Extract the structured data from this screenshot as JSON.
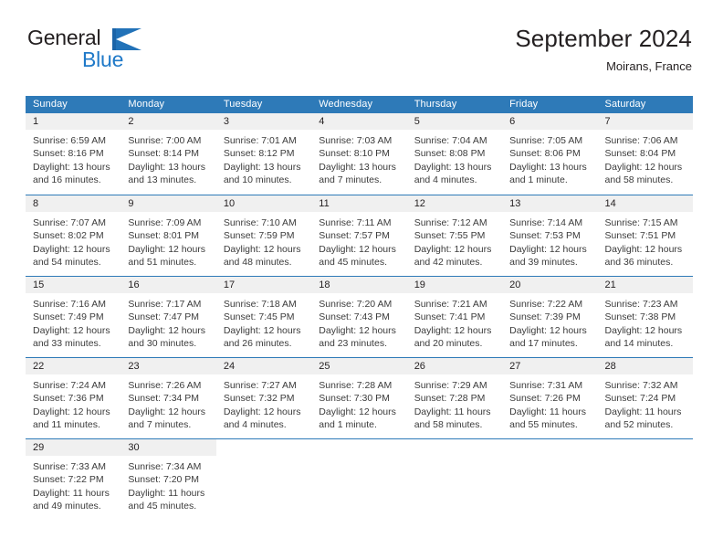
{
  "brand": {
    "name_top": "General",
    "name_bottom": "Blue",
    "mark": "flag-triangle-icon",
    "color_dark": "#231f20",
    "color_blue": "#1f79c8"
  },
  "header": {
    "title": "September 2024",
    "subtitle": "Moirans, France"
  },
  "theme": {
    "header_blue": "#2e7ab8",
    "day_number_band": "#f0f0f0",
    "text": "#231f20"
  },
  "weekdays": [
    "Sunday",
    "Monday",
    "Tuesday",
    "Wednesday",
    "Thursday",
    "Friday",
    "Saturday"
  ],
  "weeks": [
    [
      {
        "day": "1",
        "sunrise": "Sunrise: 6:59 AM",
        "sunset": "Sunset: 8:16 PM",
        "daylight": "Daylight: 13 hours and 16 minutes."
      },
      {
        "day": "2",
        "sunrise": "Sunrise: 7:00 AM",
        "sunset": "Sunset: 8:14 PM",
        "daylight": "Daylight: 13 hours and 13 minutes."
      },
      {
        "day": "3",
        "sunrise": "Sunrise: 7:01 AM",
        "sunset": "Sunset: 8:12 PM",
        "daylight": "Daylight: 13 hours and 10 minutes."
      },
      {
        "day": "4",
        "sunrise": "Sunrise: 7:03 AM",
        "sunset": "Sunset: 8:10 PM",
        "daylight": "Daylight: 13 hours and 7 minutes."
      },
      {
        "day": "5",
        "sunrise": "Sunrise: 7:04 AM",
        "sunset": "Sunset: 8:08 PM",
        "daylight": "Daylight: 13 hours and 4 minutes."
      },
      {
        "day": "6",
        "sunrise": "Sunrise: 7:05 AM",
        "sunset": "Sunset: 8:06 PM",
        "daylight": "Daylight: 13 hours and 1 minute."
      },
      {
        "day": "7",
        "sunrise": "Sunrise: 7:06 AM",
        "sunset": "Sunset: 8:04 PM",
        "daylight": "Daylight: 12 hours and 58 minutes."
      }
    ],
    [
      {
        "day": "8",
        "sunrise": "Sunrise: 7:07 AM",
        "sunset": "Sunset: 8:02 PM",
        "daylight": "Daylight: 12 hours and 54 minutes."
      },
      {
        "day": "9",
        "sunrise": "Sunrise: 7:09 AM",
        "sunset": "Sunset: 8:01 PM",
        "daylight": "Daylight: 12 hours and 51 minutes."
      },
      {
        "day": "10",
        "sunrise": "Sunrise: 7:10 AM",
        "sunset": "Sunset: 7:59 PM",
        "daylight": "Daylight: 12 hours and 48 minutes."
      },
      {
        "day": "11",
        "sunrise": "Sunrise: 7:11 AM",
        "sunset": "Sunset: 7:57 PM",
        "daylight": "Daylight: 12 hours and 45 minutes."
      },
      {
        "day": "12",
        "sunrise": "Sunrise: 7:12 AM",
        "sunset": "Sunset: 7:55 PM",
        "daylight": "Daylight: 12 hours and 42 minutes."
      },
      {
        "day": "13",
        "sunrise": "Sunrise: 7:14 AM",
        "sunset": "Sunset: 7:53 PM",
        "daylight": "Daylight: 12 hours and 39 minutes."
      },
      {
        "day": "14",
        "sunrise": "Sunrise: 7:15 AM",
        "sunset": "Sunset: 7:51 PM",
        "daylight": "Daylight: 12 hours and 36 minutes."
      }
    ],
    [
      {
        "day": "15",
        "sunrise": "Sunrise: 7:16 AM",
        "sunset": "Sunset: 7:49 PM",
        "daylight": "Daylight: 12 hours and 33 minutes."
      },
      {
        "day": "16",
        "sunrise": "Sunrise: 7:17 AM",
        "sunset": "Sunset: 7:47 PM",
        "daylight": "Daylight: 12 hours and 30 minutes."
      },
      {
        "day": "17",
        "sunrise": "Sunrise: 7:18 AM",
        "sunset": "Sunset: 7:45 PM",
        "daylight": "Daylight: 12 hours and 26 minutes."
      },
      {
        "day": "18",
        "sunrise": "Sunrise: 7:20 AM",
        "sunset": "Sunset: 7:43 PM",
        "daylight": "Daylight: 12 hours and 23 minutes."
      },
      {
        "day": "19",
        "sunrise": "Sunrise: 7:21 AM",
        "sunset": "Sunset: 7:41 PM",
        "daylight": "Daylight: 12 hours and 20 minutes."
      },
      {
        "day": "20",
        "sunrise": "Sunrise: 7:22 AM",
        "sunset": "Sunset: 7:39 PM",
        "daylight": "Daylight: 12 hours and 17 minutes."
      },
      {
        "day": "21",
        "sunrise": "Sunrise: 7:23 AM",
        "sunset": "Sunset: 7:38 PM",
        "daylight": "Daylight: 12 hours and 14 minutes."
      }
    ],
    [
      {
        "day": "22",
        "sunrise": "Sunrise: 7:24 AM",
        "sunset": "Sunset: 7:36 PM",
        "daylight": "Daylight: 12 hours and 11 minutes."
      },
      {
        "day": "23",
        "sunrise": "Sunrise: 7:26 AM",
        "sunset": "Sunset: 7:34 PM",
        "daylight": "Daylight: 12 hours and 7 minutes."
      },
      {
        "day": "24",
        "sunrise": "Sunrise: 7:27 AM",
        "sunset": "Sunset: 7:32 PM",
        "daylight": "Daylight: 12 hours and 4 minutes."
      },
      {
        "day": "25",
        "sunrise": "Sunrise: 7:28 AM",
        "sunset": "Sunset: 7:30 PM",
        "daylight": "Daylight: 12 hours and 1 minute."
      },
      {
        "day": "26",
        "sunrise": "Sunrise: 7:29 AM",
        "sunset": "Sunset: 7:28 PM",
        "daylight": "Daylight: 11 hours and 58 minutes."
      },
      {
        "day": "27",
        "sunrise": "Sunrise: 7:31 AM",
        "sunset": "Sunset: 7:26 PM",
        "daylight": "Daylight: 11 hours and 55 minutes."
      },
      {
        "day": "28",
        "sunrise": "Sunrise: 7:32 AM",
        "sunset": "Sunset: 7:24 PM",
        "daylight": "Daylight: 11 hours and 52 minutes."
      }
    ],
    [
      {
        "day": "29",
        "sunrise": "Sunrise: 7:33 AM",
        "sunset": "Sunset: 7:22 PM",
        "daylight": "Daylight: 11 hours and 49 minutes."
      },
      {
        "day": "30",
        "sunrise": "Sunrise: 7:34 AM",
        "sunset": "Sunset: 7:20 PM",
        "daylight": "Daylight: 11 hours and 45 minutes."
      },
      {
        "day": "",
        "sunrise": "",
        "sunset": "",
        "daylight": ""
      },
      {
        "day": "",
        "sunrise": "",
        "sunset": "",
        "daylight": ""
      },
      {
        "day": "",
        "sunrise": "",
        "sunset": "",
        "daylight": ""
      },
      {
        "day": "",
        "sunrise": "",
        "sunset": "",
        "daylight": ""
      },
      {
        "day": "",
        "sunrise": "",
        "sunset": "",
        "daylight": ""
      }
    ]
  ]
}
